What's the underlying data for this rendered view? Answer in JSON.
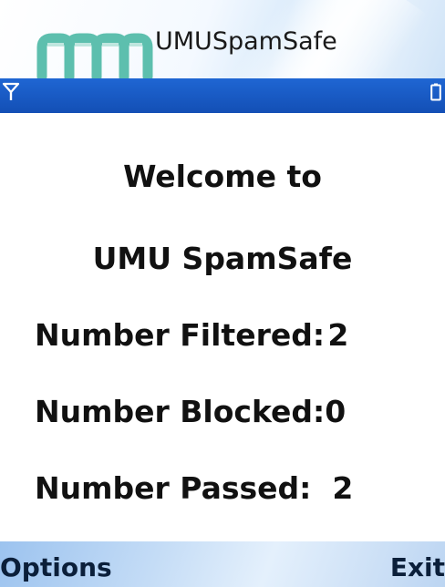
{
  "app": {
    "title": "UMUSpamSafe",
    "logo_icon": "umu-logo-icon"
  },
  "status_bar": {
    "signal_icon": "signal-icon",
    "battery_icon": "battery-icon",
    "color": "#1a5cc7"
  },
  "welcome": {
    "line1": "Welcome to",
    "line2": "UMU SpamSafe"
  },
  "stats": {
    "filtered_label": "Number Filtered:",
    "filtered_value": "2",
    "blocked_label": "Number Blocked:",
    "blocked_value": "0",
    "passed_label": "Number Passed:",
    "passed_value": "2"
  },
  "softkeys": {
    "left_label": "Options",
    "right_label": "Exit"
  },
  "colors": {
    "logo_teal": "#5dbfae",
    "status_blue": "#1a5cc7"
  }
}
